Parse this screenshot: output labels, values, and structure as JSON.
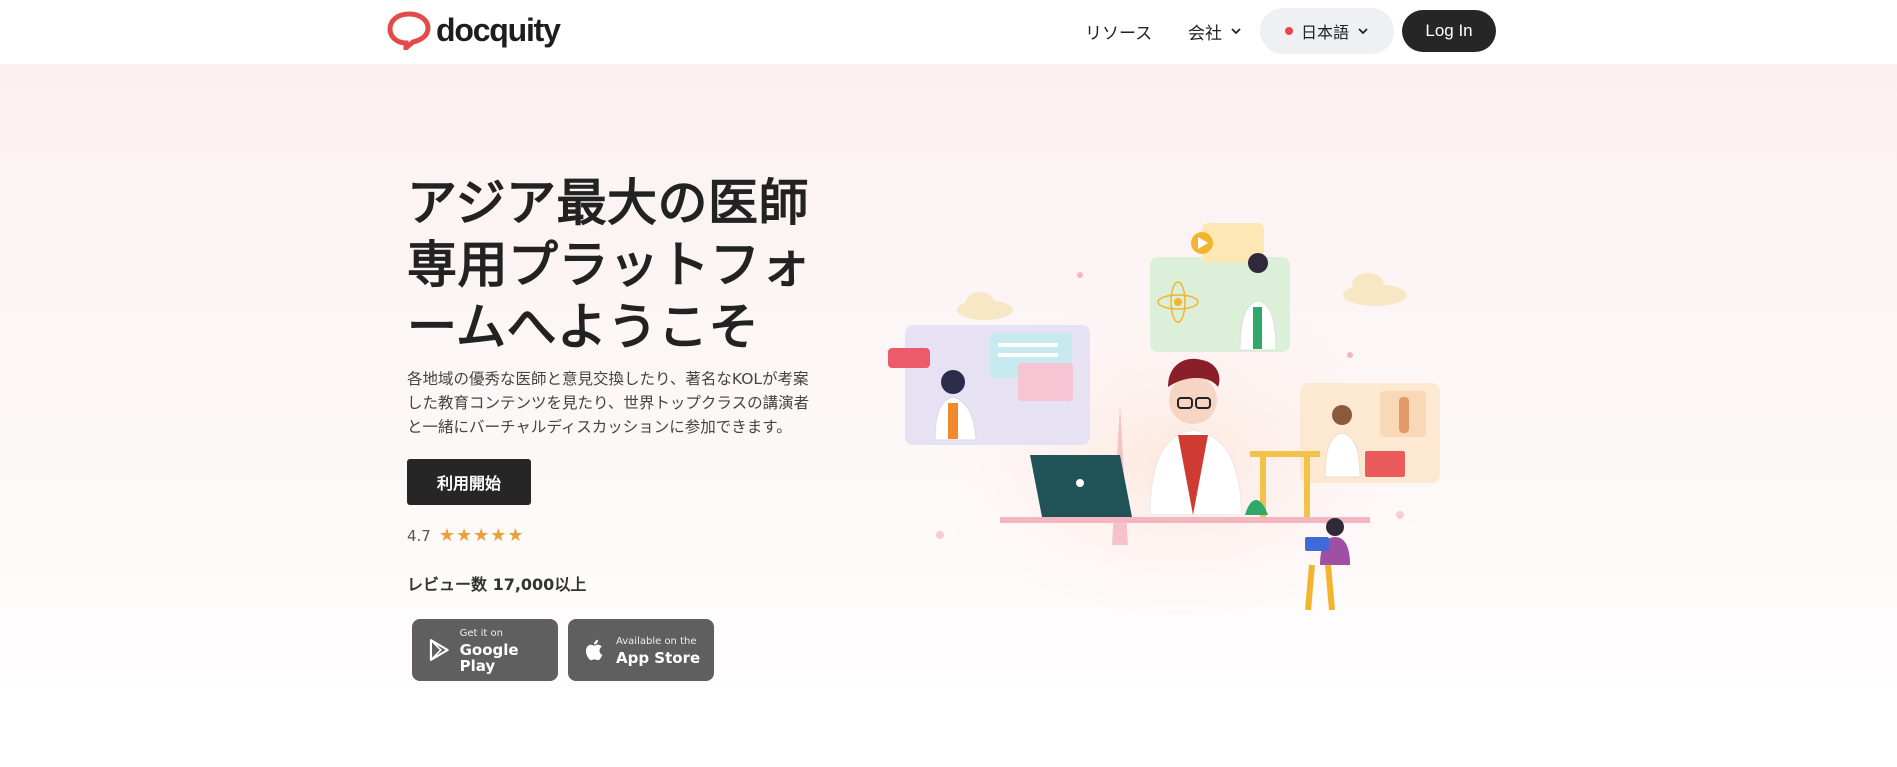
{
  "header": {
    "logo_text": "docquity",
    "nav": {
      "resources": "リソース",
      "company": "会社",
      "language": "日本語",
      "login": "Log In"
    }
  },
  "hero": {
    "title_lines": [
      "アジア最大の医師",
      "専用プラットフォ",
      "ームへようこそ"
    ],
    "description_lines": [
      "各地域の優秀な医師と意見交換したり、著名なKOLが考案",
      "した教育コンテンツを見たり、世界トップクラスの講演者",
      "と一緒にバーチャルディスカッションに参加できます。"
    ],
    "cta_label": "利用開始",
    "rating_value": "4.7",
    "rating_stars": 4.7,
    "reviews_text": "レビュー数 17,000以上"
  },
  "stores": {
    "google": {
      "small": "Get it on",
      "big": "Google Play"
    },
    "apple": {
      "small": "Available on the",
      "big": "App Store"
    }
  },
  "colors": {
    "brand_red": "#e34b4b",
    "dark_button": "#262626",
    "star": "#e9a23b",
    "hero_bg": "#fcf1f1",
    "store_button": "#5f5f5f"
  },
  "icons": [
    "docquity-logo-icon",
    "chevron-down-icon",
    "language-dot-icon",
    "star-icon",
    "google-play-icon",
    "apple-icon"
  ]
}
